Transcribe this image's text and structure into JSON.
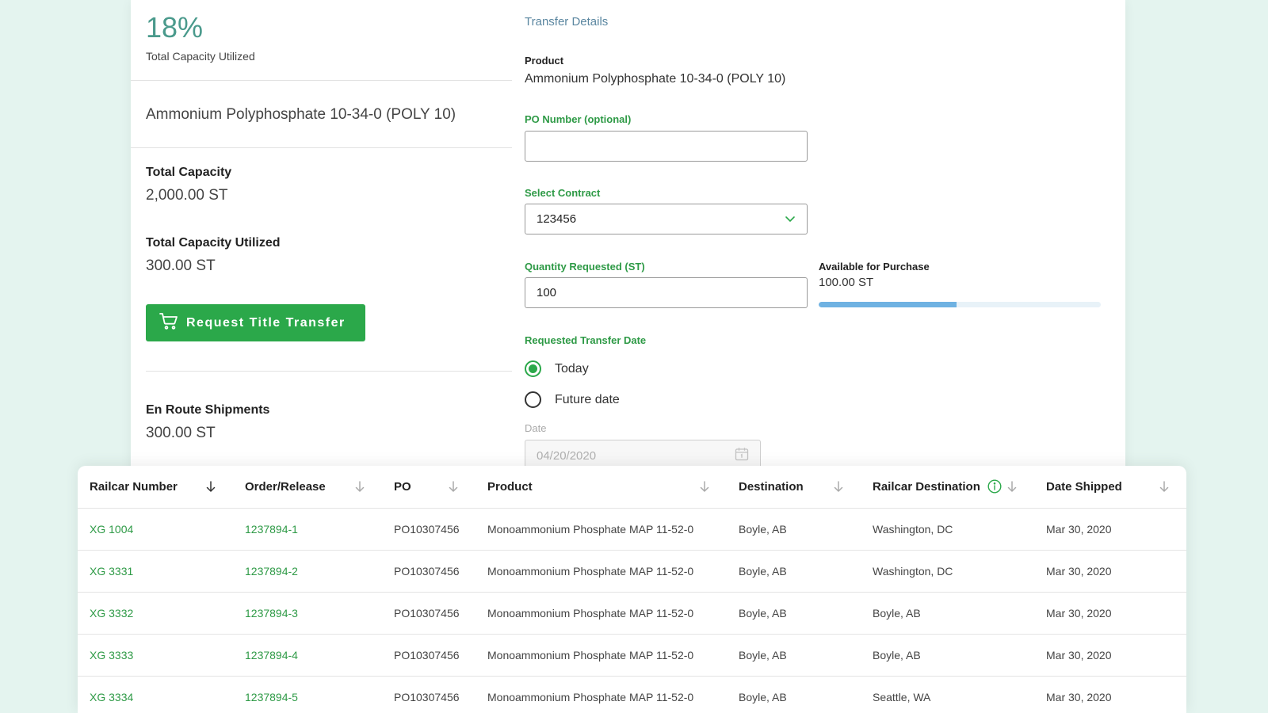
{
  "summary": {
    "utilization_pct": "18%",
    "utilization_label": "Total Capacity Utilized",
    "product_name": "Ammonium Polyphosphate 10-34-0 (POLY 10)",
    "total_capacity_label": "Total Capacity",
    "total_capacity_value": "2,000.00 ST",
    "capacity_utilized_label": "Total Capacity Utilized",
    "capacity_utilized_value": "300.00 ST",
    "request_button_label": "Request Title Transfer",
    "en_route_label": "En Route Shipments",
    "en_route_value": "300.00 ST"
  },
  "transfer": {
    "title": "Transfer Details",
    "product_label": "Product",
    "product_value": "Ammonium Polyphosphate 10-34-0 (POLY 10)",
    "po_label": "PO Number (optional)",
    "po_value": "",
    "contract_label": "Select Contract",
    "contract_value": "123456",
    "quantity_label": "Quantity Requested (ST)",
    "quantity_value": "100",
    "available_label": "Available for Purchase",
    "available_value": "100.00 ST",
    "available_progress": 0.49,
    "date_section_label": "Requested Transfer Date",
    "option_today": "Today",
    "option_future": "Future date",
    "selected_option": "Today",
    "date_label": "Date",
    "date_placeholder": "04/20/2020"
  },
  "table": {
    "columns": [
      "Railcar Number",
      "Order/Release",
      "PO",
      "Product",
      "Destination",
      "Railcar Destination",
      "Date Shipped"
    ],
    "rows": [
      [
        "XG 1004",
        "1237894-1",
        "PO10307456",
        "Monoammonium Phosphate MAP 11-52-0",
        "Boyle, AB",
        "Washington, DC",
        "Mar 30, 2020"
      ],
      [
        "XG 3331",
        "1237894-2",
        "PO10307456",
        "Monoammonium Phosphate MAP 11-52-0",
        "Boyle, AB",
        "Washington, DC",
        "Mar 30, 2020"
      ],
      [
        "XG 3332",
        "1237894-3",
        "PO10307456",
        "Monoammonium Phosphate MAP 11-52-0",
        "Boyle, AB",
        "Boyle, AB",
        "Mar 30, 2020"
      ],
      [
        "XG 3333",
        "1237894-4",
        "PO10307456",
        "Monoammonium Phosphate MAP 11-52-0",
        "Boyle, AB",
        "Boyle, AB",
        "Mar 30, 2020"
      ],
      [
        "XG 3334",
        "1237894-5",
        "PO10307456",
        "Monoammonium Phosphate MAP 11-52-0",
        "Boyle, AB",
        "Seattle, WA",
        "Mar 30, 2020"
      ]
    ]
  },
  "colors": {
    "accent_green": "#2ba84a",
    "progress_blue": "#6fb2e2",
    "background_mint": "#e4f4ef"
  }
}
